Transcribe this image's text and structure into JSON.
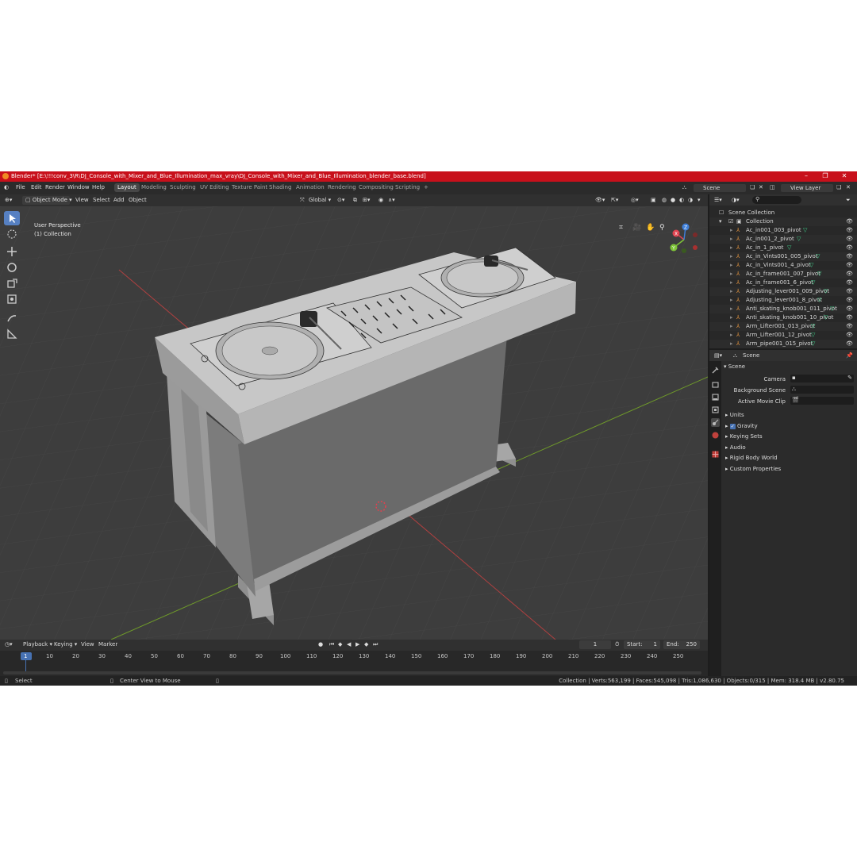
{
  "window": {
    "title": "Blender* [E:\\!!!conv_3\\R\\DJ_Console_with_Mixer_and_Blue_Illumination_max_vray\\DJ_Console_with_Mixer_and_Blue_Illumination_blender_base.blend]"
  },
  "menu": {
    "items": [
      "File",
      "Edit",
      "Render",
      "Window",
      "Help"
    ],
    "workspaces": [
      "Layout",
      "Modeling",
      "Sculpting",
      "UV Editing",
      "Texture Paint",
      "Shading",
      "Animation",
      "Rendering",
      "Compositing",
      "Scripting"
    ],
    "active_workspace": "Layout",
    "add_tab": "+",
    "scene": "Scene",
    "view_layer": "View Layer"
  },
  "viewport_header": {
    "mode": "Object Mode",
    "menus": [
      "View",
      "Select",
      "Add",
      "Object"
    ],
    "transform": "Global"
  },
  "viewport": {
    "perspective": "User Perspective",
    "collection": "(1) Collection",
    "gizmo": {
      "x": "X",
      "y": "Y",
      "z": "Z"
    }
  },
  "timeline": {
    "menus": [
      "Playback",
      "Keying",
      "View",
      "Marker"
    ],
    "current_frame": "1",
    "start_label": "Start:",
    "start": "1",
    "end_label": "End:",
    "end": "250",
    "ticks": [
      "1",
      "10",
      "20",
      "30",
      "40",
      "50",
      "60",
      "70",
      "80",
      "90",
      "100",
      "110",
      "120",
      "130",
      "140",
      "150",
      "160",
      "170",
      "180",
      "190",
      "200",
      "210",
      "220",
      "230",
      "240",
      "250"
    ]
  },
  "statusbar": {
    "select": "Select",
    "center": "Center View to Mouse",
    "stats": "Collection | Verts:563,199 | Faces:545,098 | Tris:1,086,630 | Objects:0/315 | Mem: 318.4 MB | v2.80.75"
  },
  "outliner": {
    "root": "Scene Collection",
    "collection": "Collection",
    "items": [
      "Ac_in001_003_pivot",
      "Ac_in001_2_pivot",
      "Ac_in_1_pivot",
      "Ac_in_Vints001_005_pivot",
      "Ac_in_Vints001_4_pivot",
      "Ac_in_frame001_007_pivot",
      "Ac_in_frame001_6_pivot",
      "Adjusting_lever001_009_pivot",
      "Adjusting_lever001_8_pivot",
      "Anti_skating_knob001_011_pivot",
      "Anti_skating_knob001_10_pivot",
      "Arm_Lifter001_013_pivot",
      "Arm_Lifter001_12_pivot",
      "Arm_pipe001_015_pivot"
    ]
  },
  "properties": {
    "context": "Scene",
    "panel": "Scene",
    "fields": [
      "Camera",
      "Background Scene",
      "Active Movie Clip"
    ],
    "sections": [
      "Units",
      "Gravity",
      "Keying Sets",
      "Audio",
      "Rigid Body World",
      "Custom Properties"
    ]
  },
  "colors": {
    "titlebar": "#c8101b",
    "accent": "#5680c2",
    "axis_x": "#e0424f",
    "axis_y": "#7ec338",
    "axis_z": "#3f7fd9",
    "pivot_marker": "#3fd48c",
    "object_icon": "#ee9a40"
  }
}
